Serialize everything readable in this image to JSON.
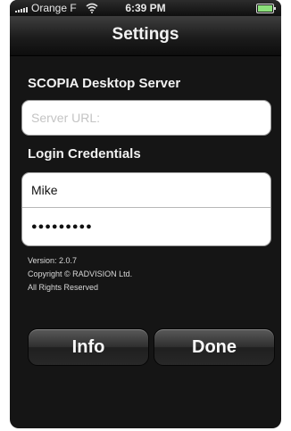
{
  "status_bar": {
    "carrier": "Orange F",
    "time": "6:39 PM"
  },
  "nav": {
    "title": "Settings"
  },
  "server_section": {
    "header": "SCOPIA Desktop Server",
    "url_placeholder": "Server URL:"
  },
  "login_section": {
    "header": "Login Credentials",
    "username": "Mike",
    "password_mask": "●●●●●●●●●"
  },
  "about": {
    "version": "Version: 2.0.7",
    "copyright": "Copyright © RADVISION Ltd.",
    "rights": "All Rights Reserved"
  },
  "buttons": {
    "info": "Info",
    "done": "Done"
  },
  "icons": {
    "signal": "signal-bars-icon",
    "wifi": "wifi-icon",
    "battery": "battery-icon"
  },
  "colors": {
    "background": "#151515",
    "battery_fill": "#8be07a"
  }
}
